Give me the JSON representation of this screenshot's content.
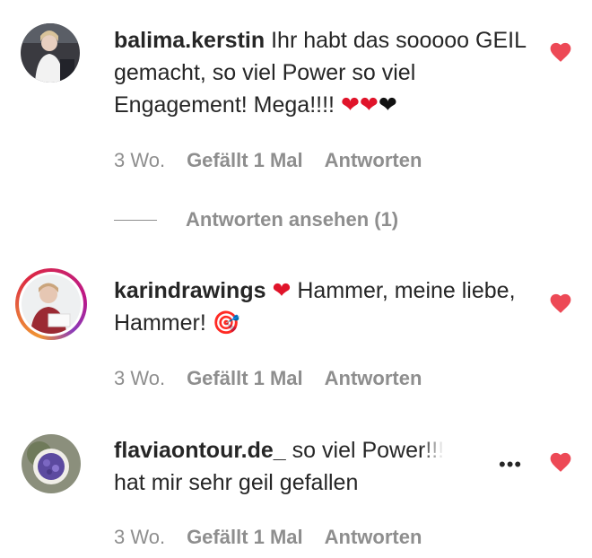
{
  "comments": [
    {
      "username": "balima.kerstin",
      "text": "Ihr habt das sooooo GEIL gemacht, so viel Power so viel Engagement! Mega!!!!",
      "emoji": [
        "❤",
        "❤",
        "❤"
      ],
      "time": "3 Wo.",
      "likes": "Gefällt 1 Mal",
      "reply": "Antworten",
      "view_replies": "Antworten ansehen (1)"
    },
    {
      "username": "karindrawings",
      "emoji_lead": "❤",
      "text": "Hammer, meine liebe, Hammer!",
      "emoji_trail": "🎯",
      "time": "3 Wo.",
      "likes": "Gefällt 1 Mal",
      "reply": "Antworten"
    },
    {
      "username": "flaviaontour.de_",
      "text_line1": "so viel Power!!!",
      "text_line2": "hat mir sehr geil gefallen",
      "more": "•••",
      "time": "3 Wo.",
      "likes": "Gefällt 1 Mal",
      "reply": "Antworten"
    }
  ],
  "icons": {
    "like": "heart-icon",
    "more": "more-options-icon"
  },
  "colors": {
    "like_red": "#ed4956",
    "text": "#262626",
    "muted": "#8e8e8e"
  }
}
